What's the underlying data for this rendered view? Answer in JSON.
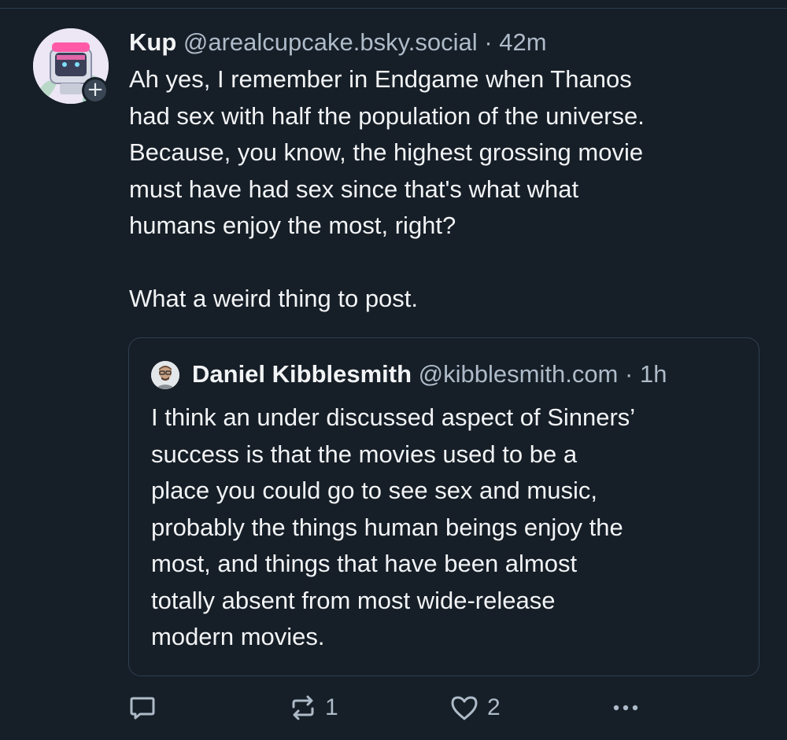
{
  "post": {
    "author": {
      "display_name": "Kup",
      "handle": "@arealcupcake.bsky.social",
      "avatar_icon": "cartoon-computer-head-avatar"
    },
    "separator": "·",
    "time": "42m",
    "follow_badge": "+",
    "text": "Ah yes, I remember in Endgame when Thanos\nhad sex with half the population of the universe.\nBecause, you know, the highest grossing movie\nmust have had sex since that's what what\nhumans enjoy the most, right?\n\nWhat a weird thing to post."
  },
  "quote": {
    "author": {
      "display_name": "Daniel Kibblesmith",
      "handle": "@kibblesmith.com",
      "avatar_icon": "man-with-glasses-avatar"
    },
    "separator": "·",
    "time": "1h",
    "text": "I think an under discussed aspect of Sinners’\nsuccess is that the movies used to be a\nplace you could go to see sex and music,\nprobably the things human beings enjoy the\nmost, and things that have been almost\ntotally absent from most wide-release\nmodern movies."
  },
  "actions": {
    "reply": {
      "icon": "reply-bubble-icon",
      "count": ""
    },
    "repost": {
      "icon": "repost-icon",
      "count": "1"
    },
    "like": {
      "icon": "heart-icon",
      "count": "2"
    },
    "more": {
      "icon": "more-dots-icon"
    }
  },
  "colors": {
    "background": "#161e27",
    "text_primary": "#f1f3f5",
    "text_secondary": "#aebbc9",
    "border": "#2e4052"
  }
}
